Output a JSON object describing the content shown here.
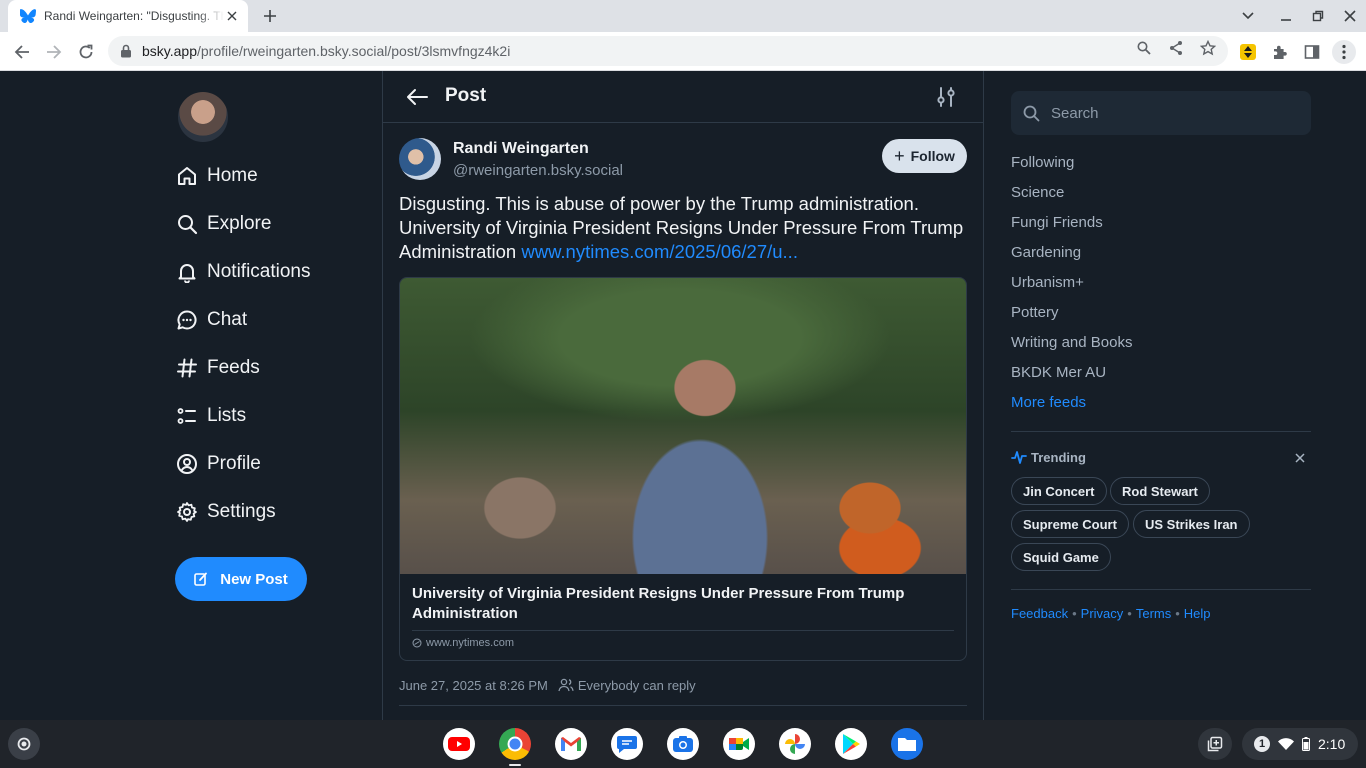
{
  "browser": {
    "tab_title": "Randi Weingarten: \"Disgusting. This is abuse of power by the Trump administration.",
    "url_host": "bsky.app",
    "url_path": "/profile/rweingarten.bsky.social/post/3lsmvfngz4k2i"
  },
  "nav": {
    "items": [
      {
        "label": "Home",
        "icon": "home-icon"
      },
      {
        "label": "Explore",
        "icon": "search-icon"
      },
      {
        "label": "Notifications",
        "icon": "bell-icon"
      },
      {
        "label": "Chat",
        "icon": "chat-icon"
      },
      {
        "label": "Feeds",
        "icon": "hash-icon"
      },
      {
        "label": "Lists",
        "icon": "list-icon"
      },
      {
        "label": "Profile",
        "icon": "user-circle-icon"
      },
      {
        "label": "Settings",
        "icon": "gear-icon"
      }
    ],
    "new_post": "New Post"
  },
  "header": {
    "title": "Post"
  },
  "post": {
    "author_name": "Randi Weingarten",
    "author_handle": "@rweingarten.bsky.social",
    "follow_label": "Follow",
    "text": "Disgusting. This is abuse of power by the Trump administration. University of Virginia President Resigns Under Pressure From Trump Administration ",
    "link_text": "www.nytimes.com/2025/06/27/u...",
    "card": {
      "title": "University of Virginia President Resigns Under Pressure From Trump Administration",
      "domain": "www.nytimes.com"
    },
    "timestamp": "June 27, 2025 at 8:26 PM",
    "reply_setting": "Everybody can reply"
  },
  "sidebar": {
    "search_placeholder": "Search",
    "feeds": [
      "Following",
      "Science",
      "Fungi Friends",
      "Gardening",
      "Urbanism+",
      "Pottery",
      "Writing and Books",
      "BKDK Mer AU"
    ],
    "more_feeds": "More feeds",
    "trending_title": "Trending",
    "trending": [
      "Jin Concert",
      "Rod Stewart",
      "Supreme Court",
      "US Strikes Iran",
      "Squid Game"
    ],
    "footer": [
      "Feedback",
      "Privacy",
      "Terms",
      "Help"
    ]
  },
  "shelf": {
    "notification_count": "1",
    "time": "2:10"
  },
  "colors": {
    "background": "#161e27",
    "accent": "#208bfe",
    "border": "#2e3a47"
  }
}
